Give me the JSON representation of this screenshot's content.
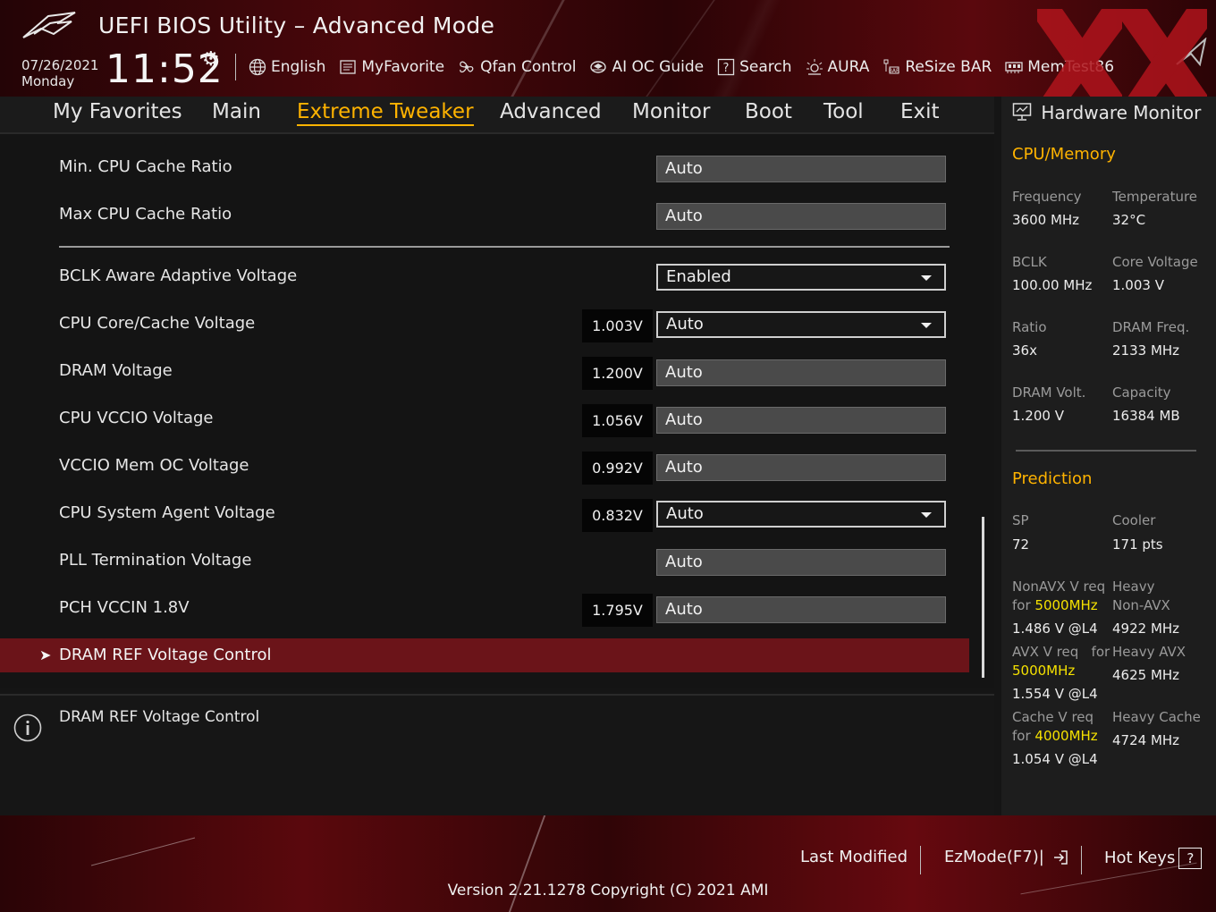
{
  "header": {
    "title": "UEFI BIOS Utility – Advanced Mode",
    "date": "07/26/2021",
    "day": "Monday",
    "time": "11:52",
    "toolbar": [
      {
        "label": "English",
        "icon": "globe-icon"
      },
      {
        "label": "MyFavorite",
        "icon": "favorite-list-icon"
      },
      {
        "label": "Qfan Control",
        "icon": "fan-icon"
      },
      {
        "label": "AI OC Guide",
        "icon": "ai-chip-icon"
      },
      {
        "label": "Search",
        "icon": "question-box-icon"
      },
      {
        "label": "AURA",
        "icon": "aura-light-icon"
      },
      {
        "label": "ReSize BAR",
        "icon": "resize-bar-icon"
      },
      {
        "label": "MemTest86",
        "icon": "memory-icon"
      }
    ]
  },
  "tabs": [
    {
      "label": "My Favorites",
      "active": false
    },
    {
      "label": "Main",
      "active": false
    },
    {
      "label": "Extreme Tweaker",
      "active": true
    },
    {
      "label": "Advanced",
      "active": false
    },
    {
      "label": "Monitor",
      "active": false
    },
    {
      "label": "Boot",
      "active": false
    },
    {
      "label": "Tool",
      "active": false
    },
    {
      "label": "Exit",
      "active": false
    }
  ],
  "settings": [
    {
      "label": "Min. CPU Cache Ratio",
      "value": "Auto"
    },
    {
      "label": "Max CPU Cache Ratio",
      "value": "Auto"
    },
    {
      "label": "BCLK Aware Adaptive Voltage",
      "value": "Enabled"
    },
    {
      "label": "CPU Core/Cache Voltage",
      "voltage": "1.003V",
      "value": "Auto"
    },
    {
      "label": "DRAM Voltage",
      "voltage": "1.200V",
      "value": "Auto"
    },
    {
      "label": "CPU VCCIO Voltage",
      "voltage": "1.056V",
      "value": "Auto"
    },
    {
      "label": "VCCIO Mem OC Voltage",
      "voltage": "0.992V",
      "value": "Auto"
    },
    {
      "label": "CPU System Agent Voltage",
      "voltage": "0.832V",
      "value": "Auto"
    },
    {
      "label": "PLL Termination Voltage",
      "value": "Auto"
    },
    {
      "label": "PCH VCCIN 1.8V",
      "voltage": "1.795V",
      "value": "Auto"
    }
  ],
  "selected_submenu": "DRAM REF Voltage Control",
  "help_text": "DRAM REF Voltage Control",
  "hw_monitor": {
    "title": "Hardware Monitor",
    "cpu_memory": {
      "heading": "CPU/Memory",
      "frequency_label": "Frequency",
      "frequency": "3600 MHz",
      "temperature_label": "Temperature",
      "temperature": "32°C",
      "bclk_label": "BCLK",
      "bclk": "100.00 MHz",
      "core_voltage_label": "Core Voltage",
      "core_voltage": "1.003 V",
      "ratio_label": "Ratio",
      "ratio": "36x",
      "dram_freq_label": "DRAM Freq.",
      "dram_freq": "2133 MHz",
      "dram_volt_label": "DRAM Volt.",
      "dram_volt": "1.200 V",
      "capacity_label": "Capacity",
      "capacity": "16384 MB"
    },
    "prediction": {
      "heading": "Prediction",
      "sp_label": "SP",
      "sp": "72",
      "cooler_label": "Cooler",
      "cooler": "171 pts",
      "nonavx_label": "NonAVX V req",
      "nonavx_for": "for",
      "nonavx_freq": "5000MHz",
      "nonavx_value": "1.486 V @L4",
      "heavy_nonavx_label1": "Heavy",
      "heavy_nonavx_label2": "Non-AVX",
      "heavy_nonavx_value": "4922 MHz",
      "avx_label": "AVX V req",
      "avx_for": "for",
      "avx_freq": "5000MHz",
      "avx_value": "1.554 V @L4",
      "heavy_avx_label": "Heavy AVX",
      "heavy_avx_value": "4625 MHz",
      "cache_label": "Cache V req",
      "cache_for": "for",
      "cache_freq": "4000MHz",
      "cache_value": "1.054 V @L4",
      "heavy_cache_label": "Heavy Cache",
      "heavy_cache_value": "4724 MHz"
    }
  },
  "footer": {
    "last_modified": "Last Modified",
    "ezmode": "EzMode(F7)|",
    "hot_keys": "Hot Keys",
    "hot_keys_badge": "?",
    "version": "Version 2.21.1278 Copyright (C) 2021 AMI"
  },
  "colors": {
    "accent": "#ffb300",
    "highlight_row": "#6b1419",
    "prediction_highlight": "#f5e100"
  }
}
